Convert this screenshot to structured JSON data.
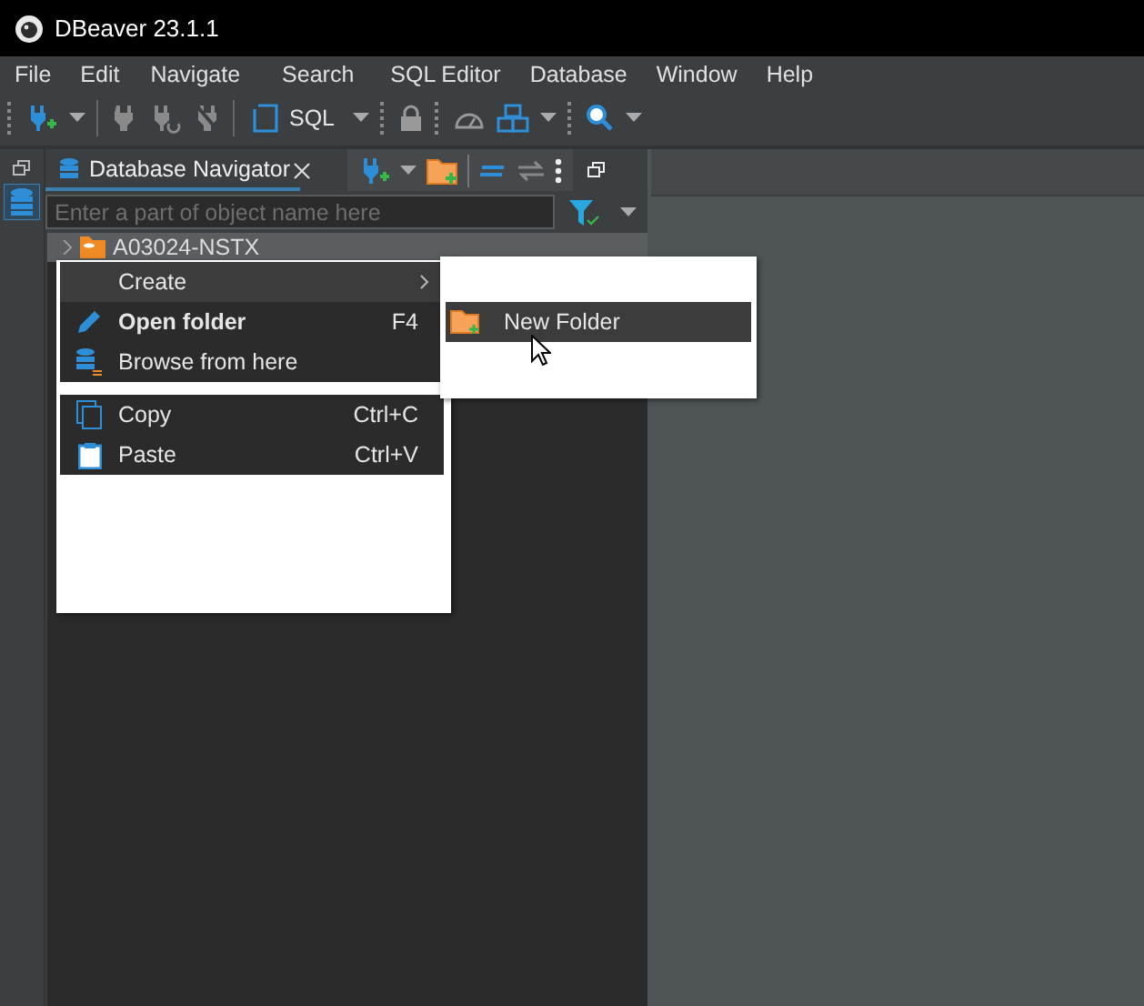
{
  "window": {
    "title": "DBeaver 23.1.1"
  },
  "menu_bar": [
    "File",
    "Edit",
    "Navigate",
    "Search",
    "SQL Editor",
    "Database",
    "Window",
    "Help"
  ],
  "toolbar": {
    "sql_button": "SQL"
  },
  "navigator": {
    "tab": {
      "label": "Database Navigator",
      "selected": true
    },
    "filter": {
      "placeholder": "Enter a part of object name here"
    },
    "tree": [
      {
        "label": "A03024-NSTX",
        "selected": true
      }
    ]
  },
  "context_menu": {
    "items": [
      {
        "kind": "submenu",
        "label": "Create",
        "selected": true
      },
      {
        "kind": "item",
        "label": "Open folder",
        "shortcut": "F4",
        "default": true,
        "selected": false
      },
      {
        "kind": "item",
        "label": "Browse from here",
        "default": false,
        "selected": false
      },
      {
        "kind": "separator"
      },
      {
        "kind": "item",
        "label": "Copy",
        "shortcut": "Ctrl+C",
        "default": false,
        "selected": false
      },
      {
        "kind": "item",
        "label": "Paste",
        "shortcut": "Ctrl+V",
        "default": false,
        "selected": false
      }
    ],
    "submenu": [
      {
        "label": "New Folder",
        "selected": true
      }
    ]
  }
}
